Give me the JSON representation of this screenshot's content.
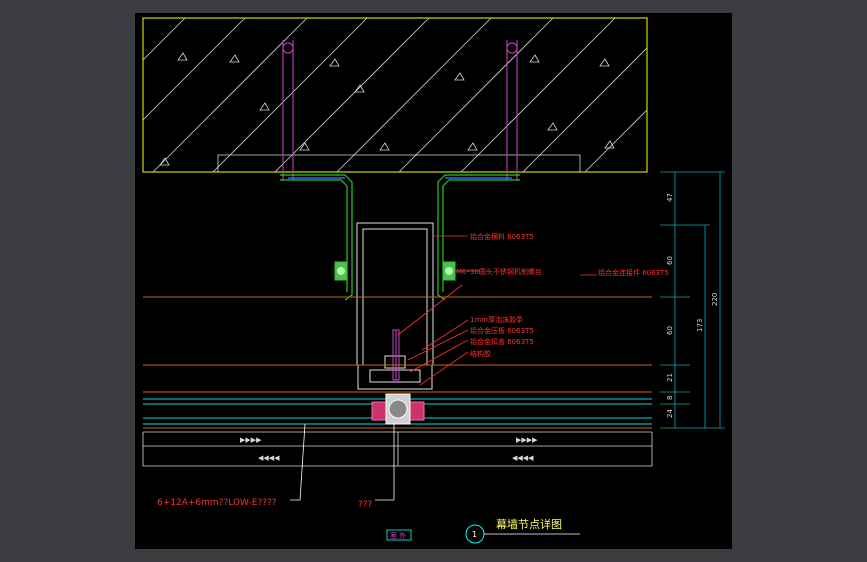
{
  "colors": {
    "background": "#3b3c40",
    "sheet": "#000000",
    "concrete": "#ffff00",
    "hatch": "#d8d8d8",
    "anchor": "#cc44cc",
    "bracket": "#22cc22",
    "mullion": "#e0e0e0",
    "label_red": "#ff3030",
    "dim_teal": "#00b0b0",
    "dim_text": "#d8d8d8",
    "glass_cyan": "#00dddd",
    "orange_line": "#cc6600",
    "title_yellow": "#ffff66",
    "circle_cyan": "#00ffff"
  },
  "labels": {
    "l1": "铝合金横料 6063T5",
    "l2": "M6*30圆头不锈钢机制螺丝",
    "l3": "铝合金连接件 6063T5",
    "l4": "1mm厚泡沫胶条",
    "l5": "铝合金压板 6063T5",
    "l6": "铝合金扣盖 6063T5",
    "l7": "结构胶"
  },
  "glass_spec": "6+12A+6mm??LOW-E????",
  "sealant_label": "???",
  "outside_label": "室 外",
  "title": {
    "number": "1",
    "text": "幕墙节点详图"
  },
  "dimensions": {
    "d47": "47",
    "d60a": "60",
    "d60b": "60",
    "d21": "21",
    "d8": "8",
    "d24": "24",
    "d173": "173",
    "d220": "220"
  },
  "glass_arrows": {
    "upper": "▶▶▶▶",
    "lower": "◀◀◀◀"
  }
}
